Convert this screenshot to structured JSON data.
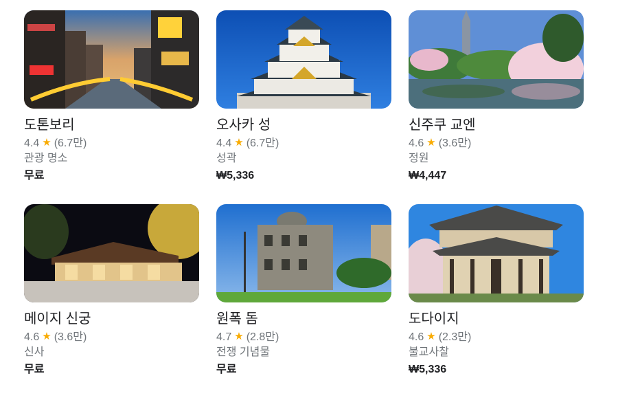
{
  "places": [
    {
      "name": "도톤보리",
      "rating": "4.4",
      "reviews": "(6.7만)",
      "category": "관광 명소",
      "price": "무료",
      "image_icon": "dotonbori-photo"
    },
    {
      "name": "오사카 성",
      "rating": "4.4",
      "reviews": "(6.7만)",
      "category": "성곽",
      "price": "₩5,336",
      "image_icon": "osaka-castle-photo"
    },
    {
      "name": "신주쿠 교엔",
      "rating": "4.6",
      "reviews": "(3.6만)",
      "category": "정원",
      "price": "₩4,447",
      "image_icon": "shinjuku-gyoen-photo"
    },
    {
      "name": "메이지 신궁",
      "rating": "4.6",
      "reviews": "(3.6만)",
      "category": "신사",
      "price": "무료",
      "image_icon": "meiji-shrine-photo"
    },
    {
      "name": "원폭 돔",
      "rating": "4.7",
      "reviews": "(2.8만)",
      "category": "전쟁 기념물",
      "price": "무료",
      "image_icon": "atomic-bomb-dome-photo"
    },
    {
      "name": "도다이지",
      "rating": "4.6",
      "reviews": "(2.3만)",
      "category": "불교사찰",
      "price": "₩5,336",
      "image_icon": "todaiji-photo"
    }
  ],
  "colors": {
    "star": "#f9ab00",
    "text_primary": "#202124",
    "text_secondary": "#70757a"
  }
}
